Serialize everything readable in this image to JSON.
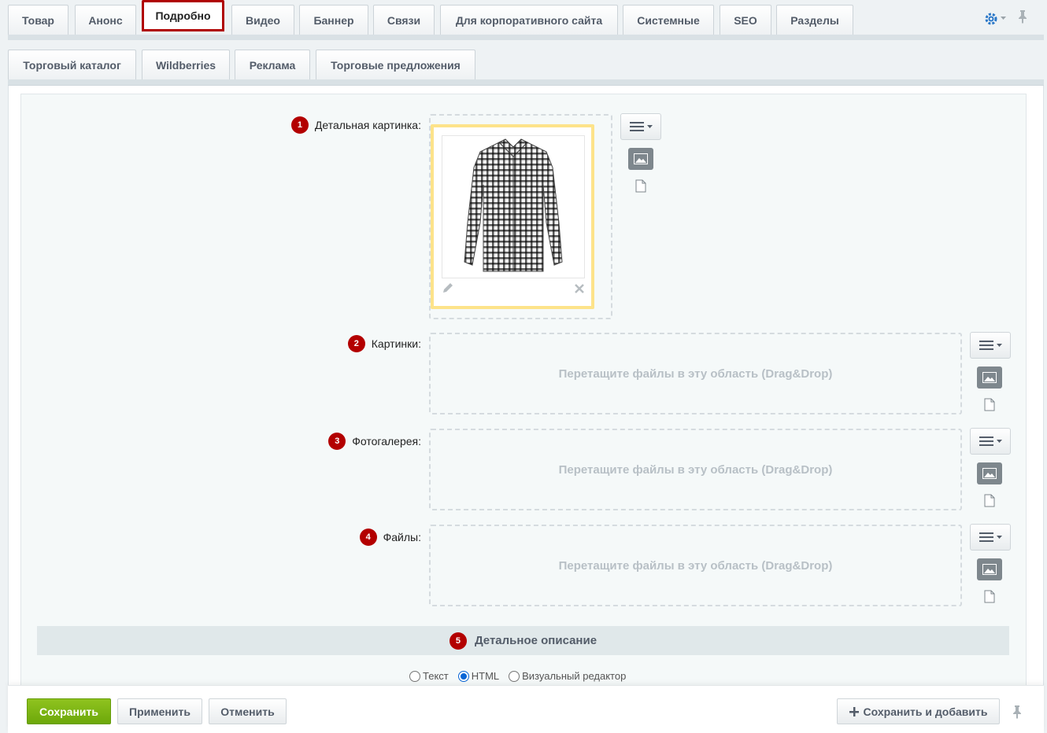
{
  "tabs_row1": [
    {
      "label": "Товар"
    },
    {
      "label": "Анонс"
    },
    {
      "label": "Подробно"
    },
    {
      "label": "Видео"
    },
    {
      "label": "Баннер"
    },
    {
      "label": "Связи"
    },
    {
      "label": "Для корпоративного сайта"
    },
    {
      "label": "Системные"
    },
    {
      "label": "SEO"
    },
    {
      "label": "Разделы"
    }
  ],
  "tabs_row2": [
    {
      "label": "Торговый каталог"
    },
    {
      "label": "Wildberries"
    },
    {
      "label": "Реклама"
    },
    {
      "label": "Торговые предложения"
    }
  ],
  "active_tab": "Подробно",
  "fields": {
    "detail_picture": {
      "badge": "1",
      "label": "Детальная картинка:"
    },
    "pictures": {
      "badge": "2",
      "label": "Картинки:",
      "placeholder": "Перетащите файлы в эту область (Drag&Drop)"
    },
    "gallery": {
      "badge": "3",
      "label": "Фотогалерея:",
      "placeholder": "Перетащите файлы в эту область (Drag&Drop)"
    },
    "files": {
      "badge": "4",
      "label": "Файлы:",
      "placeholder": "Перетащите файлы в эту область (Drag&Drop)"
    }
  },
  "section": {
    "badge": "5",
    "title": "Детальное описание"
  },
  "editor_mode": {
    "options": [
      "Текст",
      "HTML",
      "Визуальный редактор"
    ],
    "selected": "HTML"
  },
  "footer": {
    "save": "Сохранить",
    "apply": "Применить",
    "cancel": "Отменить",
    "save_add": "Сохранить и добавить"
  },
  "colors": {
    "badge": "#b30000",
    "active_tab_border": "#b00000",
    "save_green": "#7ab317",
    "preview_border": "#fde38a"
  }
}
